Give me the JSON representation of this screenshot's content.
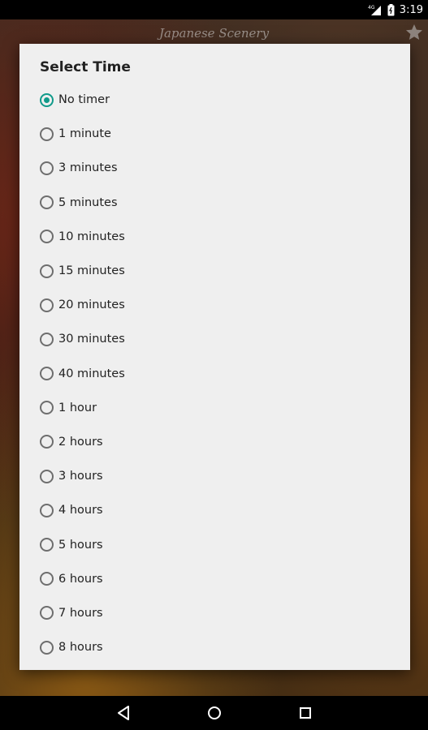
{
  "status_bar": {
    "time": "3:19",
    "icons": [
      "signal-icon",
      "battery-icon"
    ],
    "network_label": "4G"
  },
  "app": {
    "title": "Japanese Scenery",
    "favorite_icon": "star-icon"
  },
  "dialog": {
    "title": "Select Time",
    "selected_index": 0,
    "accent_color": "#109a8a",
    "options": [
      {
        "label": "No timer",
        "checked": true
      },
      {
        "label": "1 minute",
        "checked": false
      },
      {
        "label": "3 minutes",
        "checked": false
      },
      {
        "label": "5 minutes",
        "checked": false
      },
      {
        "label": "10 minutes",
        "checked": false
      },
      {
        "label": "15 minutes",
        "checked": false
      },
      {
        "label": "20 minutes",
        "checked": false
      },
      {
        "label": "30 minutes",
        "checked": false
      },
      {
        "label": "40 minutes",
        "checked": false
      },
      {
        "label": "1 hour",
        "checked": false
      },
      {
        "label": "2 hours",
        "checked": false
      },
      {
        "label": "3 hours",
        "checked": false
      },
      {
        "label": "4 hours",
        "checked": false
      },
      {
        "label": "5 hours",
        "checked": false
      },
      {
        "label": "6 hours",
        "checked": false
      },
      {
        "label": "7 hours",
        "checked": false
      },
      {
        "label": "8 hours",
        "checked": false
      }
    ]
  },
  "nav_bar": {
    "buttons": [
      "back-icon",
      "home-icon",
      "recents-icon"
    ]
  }
}
